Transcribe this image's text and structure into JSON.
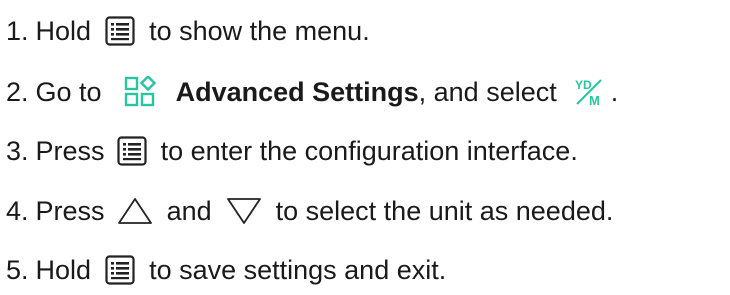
{
  "steps": [
    {
      "num": "1.",
      "a": "Hold",
      "b": "to show the menu."
    },
    {
      "num": "2.",
      "a": "Go to",
      "bold": "Advanced Settings",
      "b": ", and select",
      "c": "."
    },
    {
      "num": "3.",
      "a": "Press",
      "b": "to enter the configuration interface."
    },
    {
      "num": "4.",
      "a": "Press",
      "mid": "and",
      "b": "to select the unit as needed."
    },
    {
      "num": "5.",
      "a": "Hold",
      "b": "to save settings and exit."
    }
  ],
  "icons": {
    "menu": "menu-button-icon",
    "advanced_settings": "advanced-settings-icon",
    "unit": "unit-yd-m-icon",
    "up": "up-triangle-icon",
    "down": "down-triangle-icon"
  },
  "unit_icon_text": {
    "top": "YD",
    "bottom": "M"
  },
  "colors": {
    "text": "#1a1a1a",
    "accent": "#27c6a0"
  }
}
